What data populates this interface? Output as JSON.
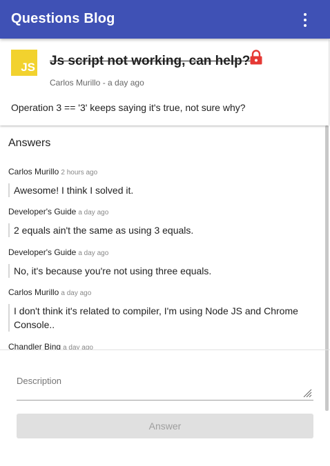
{
  "app": {
    "title": "Questions Blog"
  },
  "icons": {
    "menu": "more-vert-icon",
    "lock": "lock-icon",
    "logo": "js-logo",
    "grip": "resize-grip-icon"
  },
  "colors": {
    "primary": "#3f51b5",
    "lock": "#e53935",
    "js_logo": "#f2d22e"
  },
  "question": {
    "logo_text": "JS",
    "title": "Js script not working, can help?",
    "author": "Carlos Murillo",
    "time": "a day ago",
    "body": "Operation 3 == '3' keeps saying it's true, not sure why?"
  },
  "answers_heading": "Answers",
  "answers": [
    {
      "author": "Carlos Murillo",
      "time": "2 hours ago",
      "text": "Awesome! I think I solved it."
    },
    {
      "author": "Developer's Guide",
      "time": "a day ago",
      "text": "2 equals ain't the same as using 3 equals."
    },
    {
      "author": "Developer's Guide",
      "time": "a day ago",
      "text": "No, it's because you're not using three equals."
    },
    {
      "author": "Carlos Murillo",
      "time": "a day ago",
      "text": "I don't think it's related to compiler, I'm using Node JS and Chrome Console.."
    },
    {
      "author": "Chandler Bing",
      "time": "a day ago",
      "text": ""
    }
  ],
  "form": {
    "description_label": "Description",
    "description_value": "",
    "submit_label": "Answer"
  }
}
